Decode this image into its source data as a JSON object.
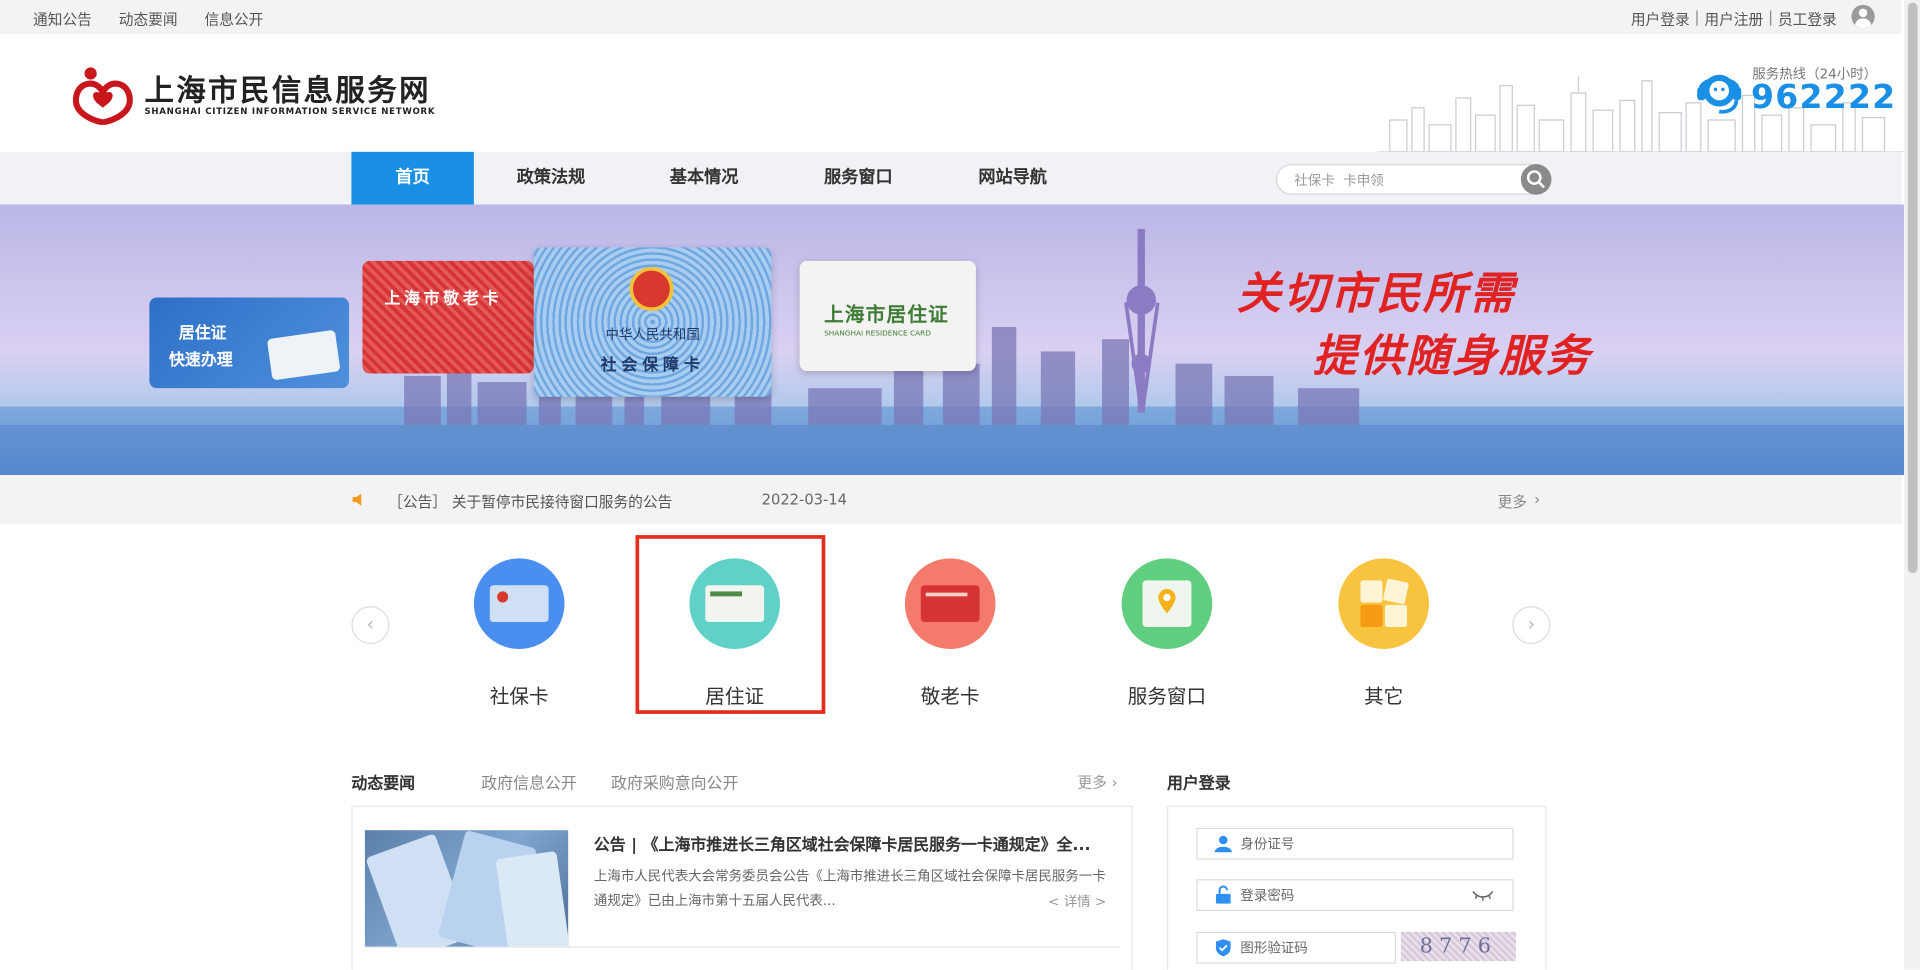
{
  "topbar": {
    "links": [
      "通知公告",
      "动态要闻",
      "信息公开"
    ],
    "user_login": "用户登录",
    "user_register": "用户注册",
    "staff_login": "员工登录",
    "separator": "|"
  },
  "header": {
    "site_title": "上海市民信息服务网",
    "site_subtitle": "SHANGHAI CITIZEN INFORMATION SERVICE NETWORK",
    "hotline_label": "服务热线（24小时）",
    "hotline_number": "962222"
  },
  "nav": {
    "items": [
      "首页",
      "政策法规",
      "基本情况",
      "服务窗口",
      "网站导航"
    ],
    "active_index": 0,
    "search_placeholder": "社保卡  卡申领"
  },
  "banner": {
    "slogan_line1": "关切市民所需",
    "slogan_line2": "提供随身服务",
    "card_residence_small_line1": "居住证",
    "card_residence_small_line2": "快速办理",
    "card_elder": "上海市敬老卡",
    "card_social_country": "中华人民共和国",
    "card_social_title": "社会保障卡",
    "card_residence_title": "上海市居住证",
    "card_residence_en": "SHANGHAI RESIDENCE CARD"
  },
  "notice": {
    "tag": "［公告］",
    "title": "关于暂停市民接待窗口服务的公告",
    "date": "2022-03-14",
    "more": "更多"
  },
  "services": {
    "items": [
      {
        "label": "社保卡",
        "color": "#4a8ff0"
      },
      {
        "label": "居住证",
        "color": "#5fd1c7"
      },
      {
        "label": "敬老卡",
        "color": "#f47a6b"
      },
      {
        "label": "服务窗口",
        "color": "#5fcf7f"
      },
      {
        "label": "其它",
        "color": "#f8c33f"
      }
    ],
    "prev": "‹",
    "next": "›"
  },
  "news": {
    "tabs": [
      "动态要闻",
      "政府信息公开",
      "政府采购意向公开"
    ],
    "more": "更多",
    "title": "公告 | 《上海市推进长三角区域社会保障卡居民服务一卡通规定》全...",
    "summary": "上海市人民代表大会常务委员会公告《上海市推进长三角区域社会保障卡居民服务一卡通规定》已由上海市第十五届人民代表...",
    "detail": "< 详情 >"
  },
  "login": {
    "title": "用户登录",
    "id_placeholder": "身份证号",
    "password_placeholder": "登录密码",
    "captcha_placeholder": "图形验证码",
    "captcha_text": "8776"
  },
  "colors": {
    "accent": "#1a8fe6",
    "slogan": "#e02222",
    "highlight": "#e42d1d"
  }
}
